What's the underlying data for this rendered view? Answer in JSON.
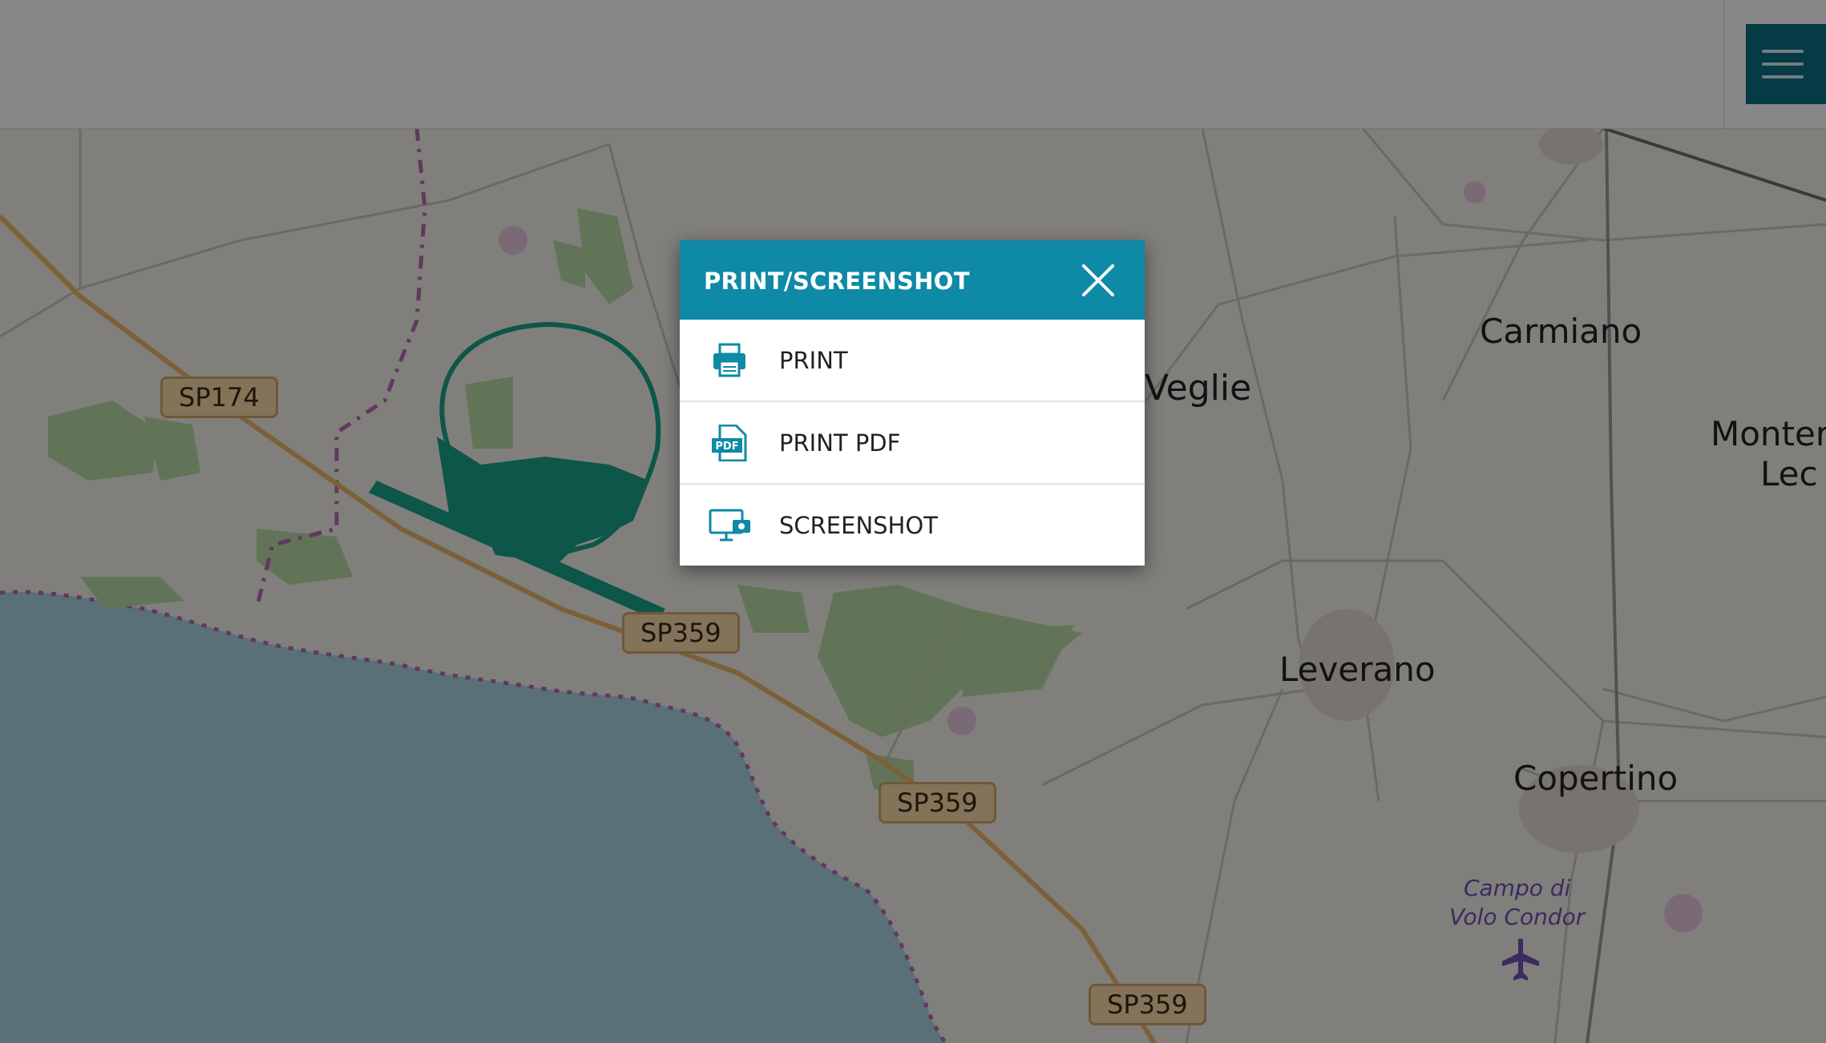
{
  "map": {
    "places": {
      "veglie": "Veglie",
      "carmiano": "Carmiano",
      "monteroni_line1": "Montero",
      "monteroni_line2": "Lec",
      "leverano": "Leverano",
      "copertino": "Copertino",
      "airport_line1": "Campo di",
      "airport_line2": "Volo Condor"
    },
    "roads": {
      "sp174": "SP174",
      "sp359_a": "SP359",
      "sp359_b": "SP359",
      "sp359_c": "SP359"
    },
    "colors": {
      "land": "#f3f0ea",
      "sea": "#a9d3df",
      "forest": "#b7dba7",
      "highlight": "#1aa38b",
      "road": "#eab56a"
    }
  },
  "header": {
    "menu_icon": "hamburger-icon",
    "menu_button_color": "#0c6e82"
  },
  "modal": {
    "title": "PRINT/SCREENSHOT",
    "close_icon": "close-icon",
    "header_color": "#0e8aa6",
    "items": [
      {
        "label": "PRINT",
        "icon": "printer-icon"
      },
      {
        "label": "PRINT PDF",
        "icon": "pdf-file-icon"
      },
      {
        "label": "SCREENSHOT",
        "icon": "monitor-camera-icon"
      }
    ]
  }
}
